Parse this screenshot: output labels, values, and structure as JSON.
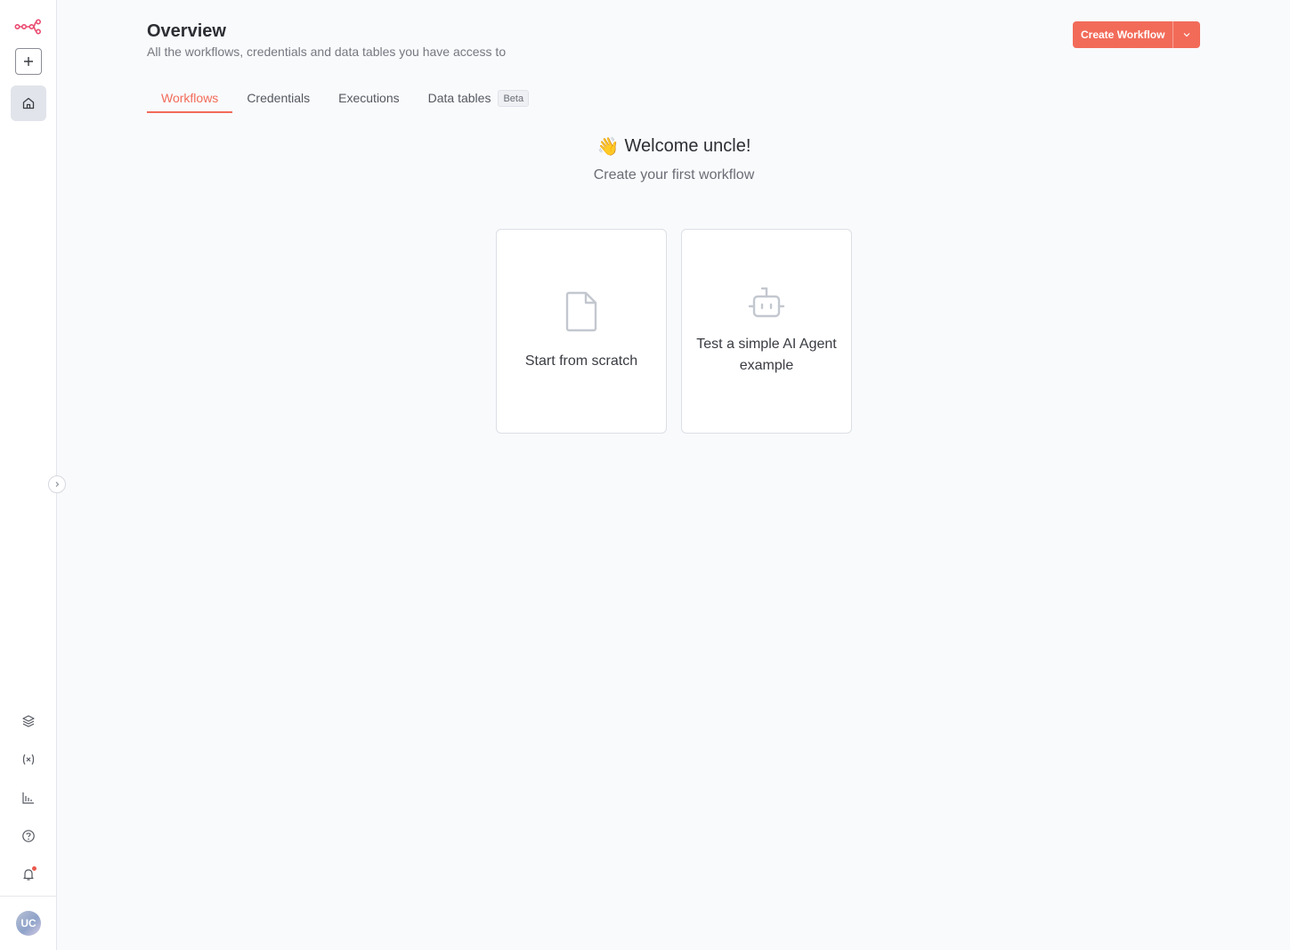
{
  "sidebar": {
    "logo": "n8n-logo-icon",
    "new_label": "+",
    "avatar_initials": "UC",
    "icons": [
      "home-icon",
      "templates-icon",
      "variables-icon",
      "insights-icon",
      "help-icon",
      "bell-icon"
    ]
  },
  "header": {
    "title": "Overview",
    "subtitle": "All the workflows, credentials and data tables you have access to",
    "create_label": "Create Workflow"
  },
  "tabs": [
    {
      "label": "Workflows",
      "active": true
    },
    {
      "label": "Credentials",
      "active": false
    },
    {
      "label": "Executions",
      "active": false
    },
    {
      "label": "Data tables",
      "badge": "Beta",
      "active": false
    }
  ],
  "empty_state": {
    "emoji": "👋",
    "title": "Welcome uncle!",
    "subtitle": "Create your first workflow",
    "cards": [
      {
        "label": "Start from scratch",
        "icon": "file-icon"
      },
      {
        "label": "Test a simple AI Agent example",
        "icon": "robot-icon"
      }
    ]
  },
  "colors": {
    "accent": "#f26b59",
    "sidebar_bg": "#ffffff",
    "page_bg": "#f9fafc"
  }
}
